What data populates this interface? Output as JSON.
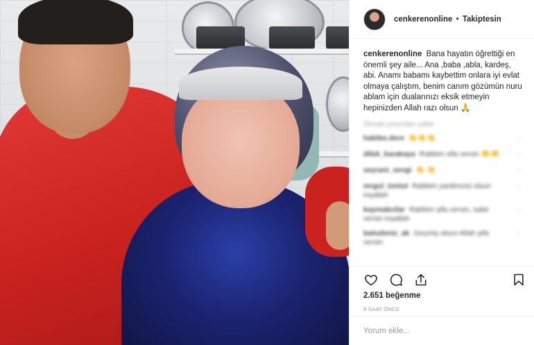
{
  "post": {
    "username": "cenkerenonline",
    "follow_status": "Takiptesin",
    "separator": "•",
    "caption": "Bana hayatın öğrettiği en önemli şey aile... Ana ,baba ,abla, kardeş, abi. Anamı babamı kaybettim onlara iyi evlat olmaya çalıştım, benim canım gözümün nuru ablam için dualarınızı eksik etmeyin hepinizden Allah razı olsun",
    "caption_emoji": "🙏"
  },
  "comments": {
    "view_all": "Önceki yorumları yükle",
    "items": [
      {
        "user": "habibe.dere",
        "text": "👏👏👏"
      },
      {
        "user": "dilek_karakaya",
        "text": "Rabbim sifa versin 🤲🤲"
      },
      {
        "user": "seyrani_sevgi",
        "text": "👏 👏"
      },
      {
        "user": "mrgul_tontul",
        "text": "Rabbim yardimcisi olsun inşallah"
      },
      {
        "user": "kaymakcilar",
        "text": "Rabbim şifa versin, sabir versin inşallah"
      },
      {
        "user": "batudeniz_ak",
        "text": "Geçmiş olsun Allah şifa versin"
      }
    ]
  },
  "actions": {
    "like_icon": "heart-outline-icon",
    "comment_icon": "speech-bubble-icon",
    "share_icon": "share-upload-icon",
    "save_icon": "bookmark-icon"
  },
  "likes": "2.651 beğenme",
  "timestamp": "8 SAAT ÖNCE",
  "add_comment": {
    "placeholder": "Yorum ekle..."
  },
  "colors": {
    "text": "#262626",
    "muted": "#999999",
    "border": "#efefef"
  }
}
